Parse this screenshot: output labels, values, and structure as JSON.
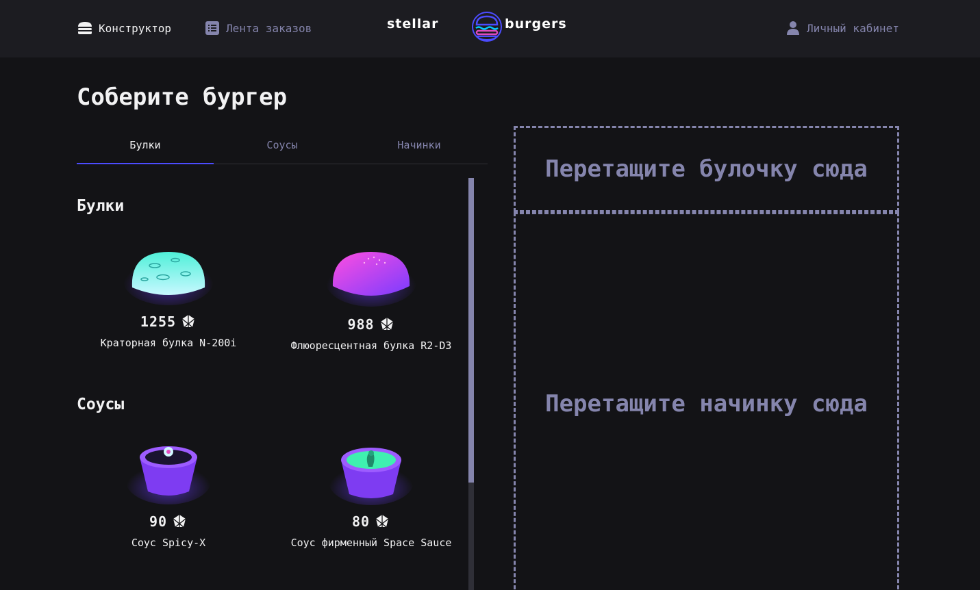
{
  "header": {
    "constructor_label": "Конструктор",
    "feed_label": "Лента заказов",
    "profile_label": "Личный кабинет",
    "logo_left": "stellar",
    "logo_right": "burgers"
  },
  "main": {
    "title": "Соберите бургер",
    "tabs": [
      {
        "label": "Булки",
        "active": true
      },
      {
        "label": "Соусы",
        "active": false
      },
      {
        "label": "Начинки",
        "active": false
      }
    ],
    "sections": [
      {
        "title": "Булки",
        "items": [
          {
            "name": "Краторная булка N-200i",
            "price": "1255",
            "image": "crater-bun"
          },
          {
            "name": "Флюоресцентная булка R2-D3",
            "price": "988",
            "image": "fluorescent-bun"
          }
        ]
      },
      {
        "title": "Соусы",
        "items": [
          {
            "name": "Соус Spicy-X",
            "price": "90",
            "image": "spicy-sauce"
          },
          {
            "name": "Соус фирменный Space Sauce",
            "price": "80",
            "image": "space-sauce"
          }
        ]
      }
    ]
  },
  "constructor": {
    "bun_placeholder": "Перетащите булочку сюда",
    "filling_placeholder": "Перетащите начинку сюда"
  },
  "colors": {
    "background": "#131316",
    "header": "#1c1c21",
    "accent": "#4c4cff",
    "muted": "#8585ad",
    "text": "#f2f2f3"
  },
  "icons": [
    "burger-icon",
    "list-icon",
    "profile-icon",
    "currency-icon"
  ]
}
